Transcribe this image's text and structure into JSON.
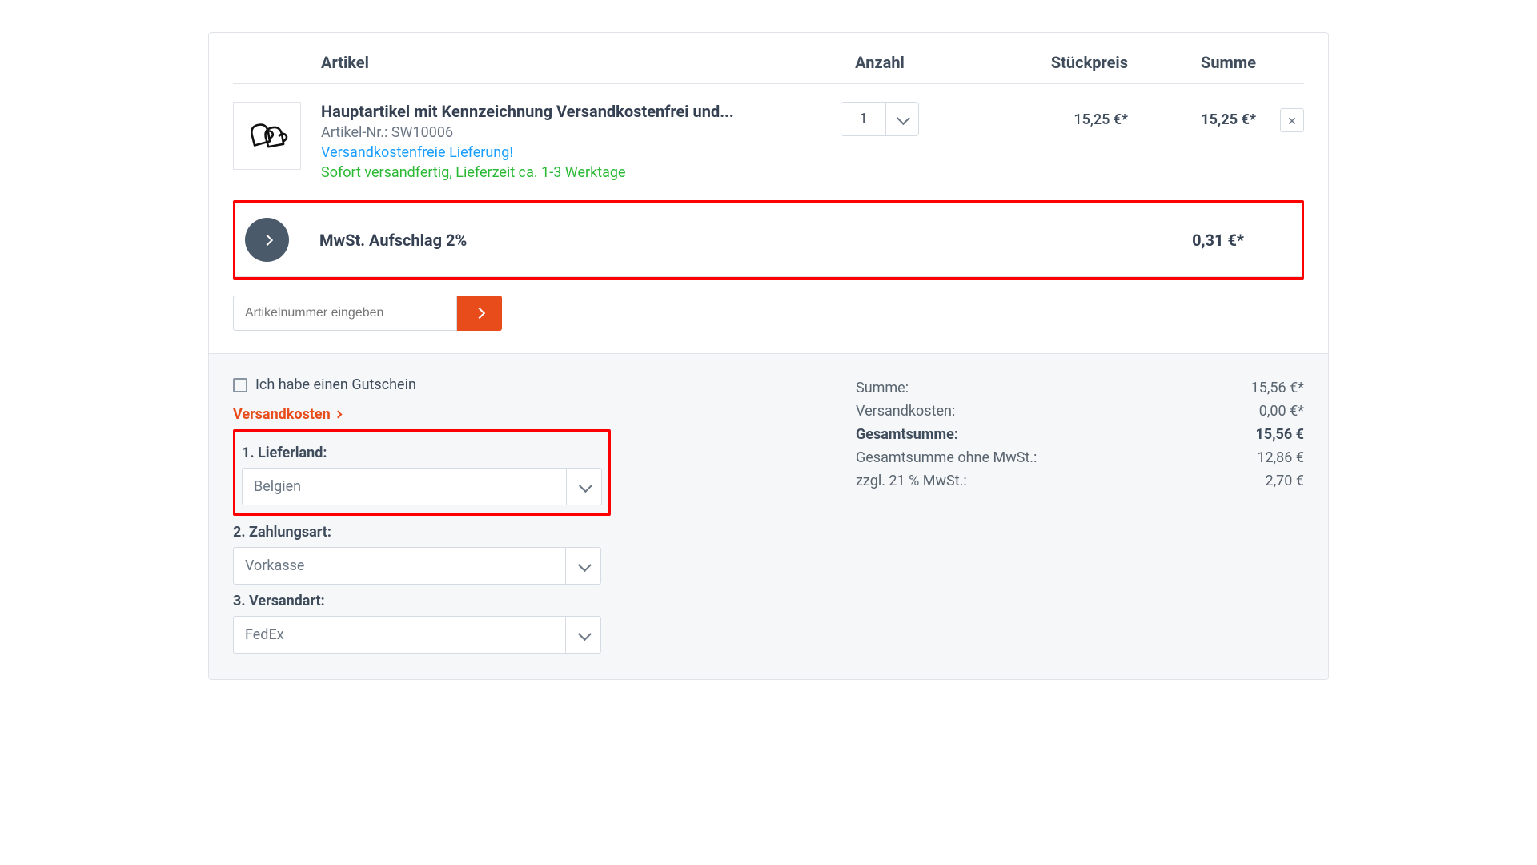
{
  "table": {
    "headers": {
      "article": "Artikel",
      "qty": "Anzahl",
      "unit": "Stückpreis",
      "sum": "Summe"
    },
    "item": {
      "title": "Hauptartikel mit Kennzeichnung Versandkostenfrei und...",
      "sku_label": "Artikel-Nr.: SW10006",
      "free_shipping": "Versandkostenfreie Lieferung!",
      "availability": "Sofort versandfertig, Lieferzeit ca. 1-3 Werktage",
      "qty": "1",
      "unit_price": "15,25 €*",
      "line_sum": "15,25 €*"
    },
    "surcharge": {
      "label": "MwSt. Aufschlag 2%",
      "amount": "0,31 €*"
    },
    "add_sku_placeholder": "Artikelnummer eingeben"
  },
  "footer": {
    "voucher_label": "Ich habe einen Gutschein",
    "shipping_link": "Versandkosten",
    "country": {
      "label": "1. Lieferland:",
      "value": "Belgien"
    },
    "payment": {
      "label": "2. Zahlungsart:",
      "value": "Vorkasse"
    },
    "shipping_method": {
      "label": "3. Versandart:",
      "value": "FedEx"
    },
    "totals": {
      "subtotal_label": "Summe:",
      "subtotal_value": "15,56 €*",
      "shipping_label": "Versandkosten:",
      "shipping_value": "0,00 €*",
      "grand_label": "Gesamtsumme:",
      "grand_value": "15,56 €",
      "net_label": "Gesamtsumme ohne MwSt.:",
      "net_value": "12,86 €",
      "vat_label": "zzgl. 21 % MwSt.:",
      "vat_value": "2,70 €"
    }
  }
}
